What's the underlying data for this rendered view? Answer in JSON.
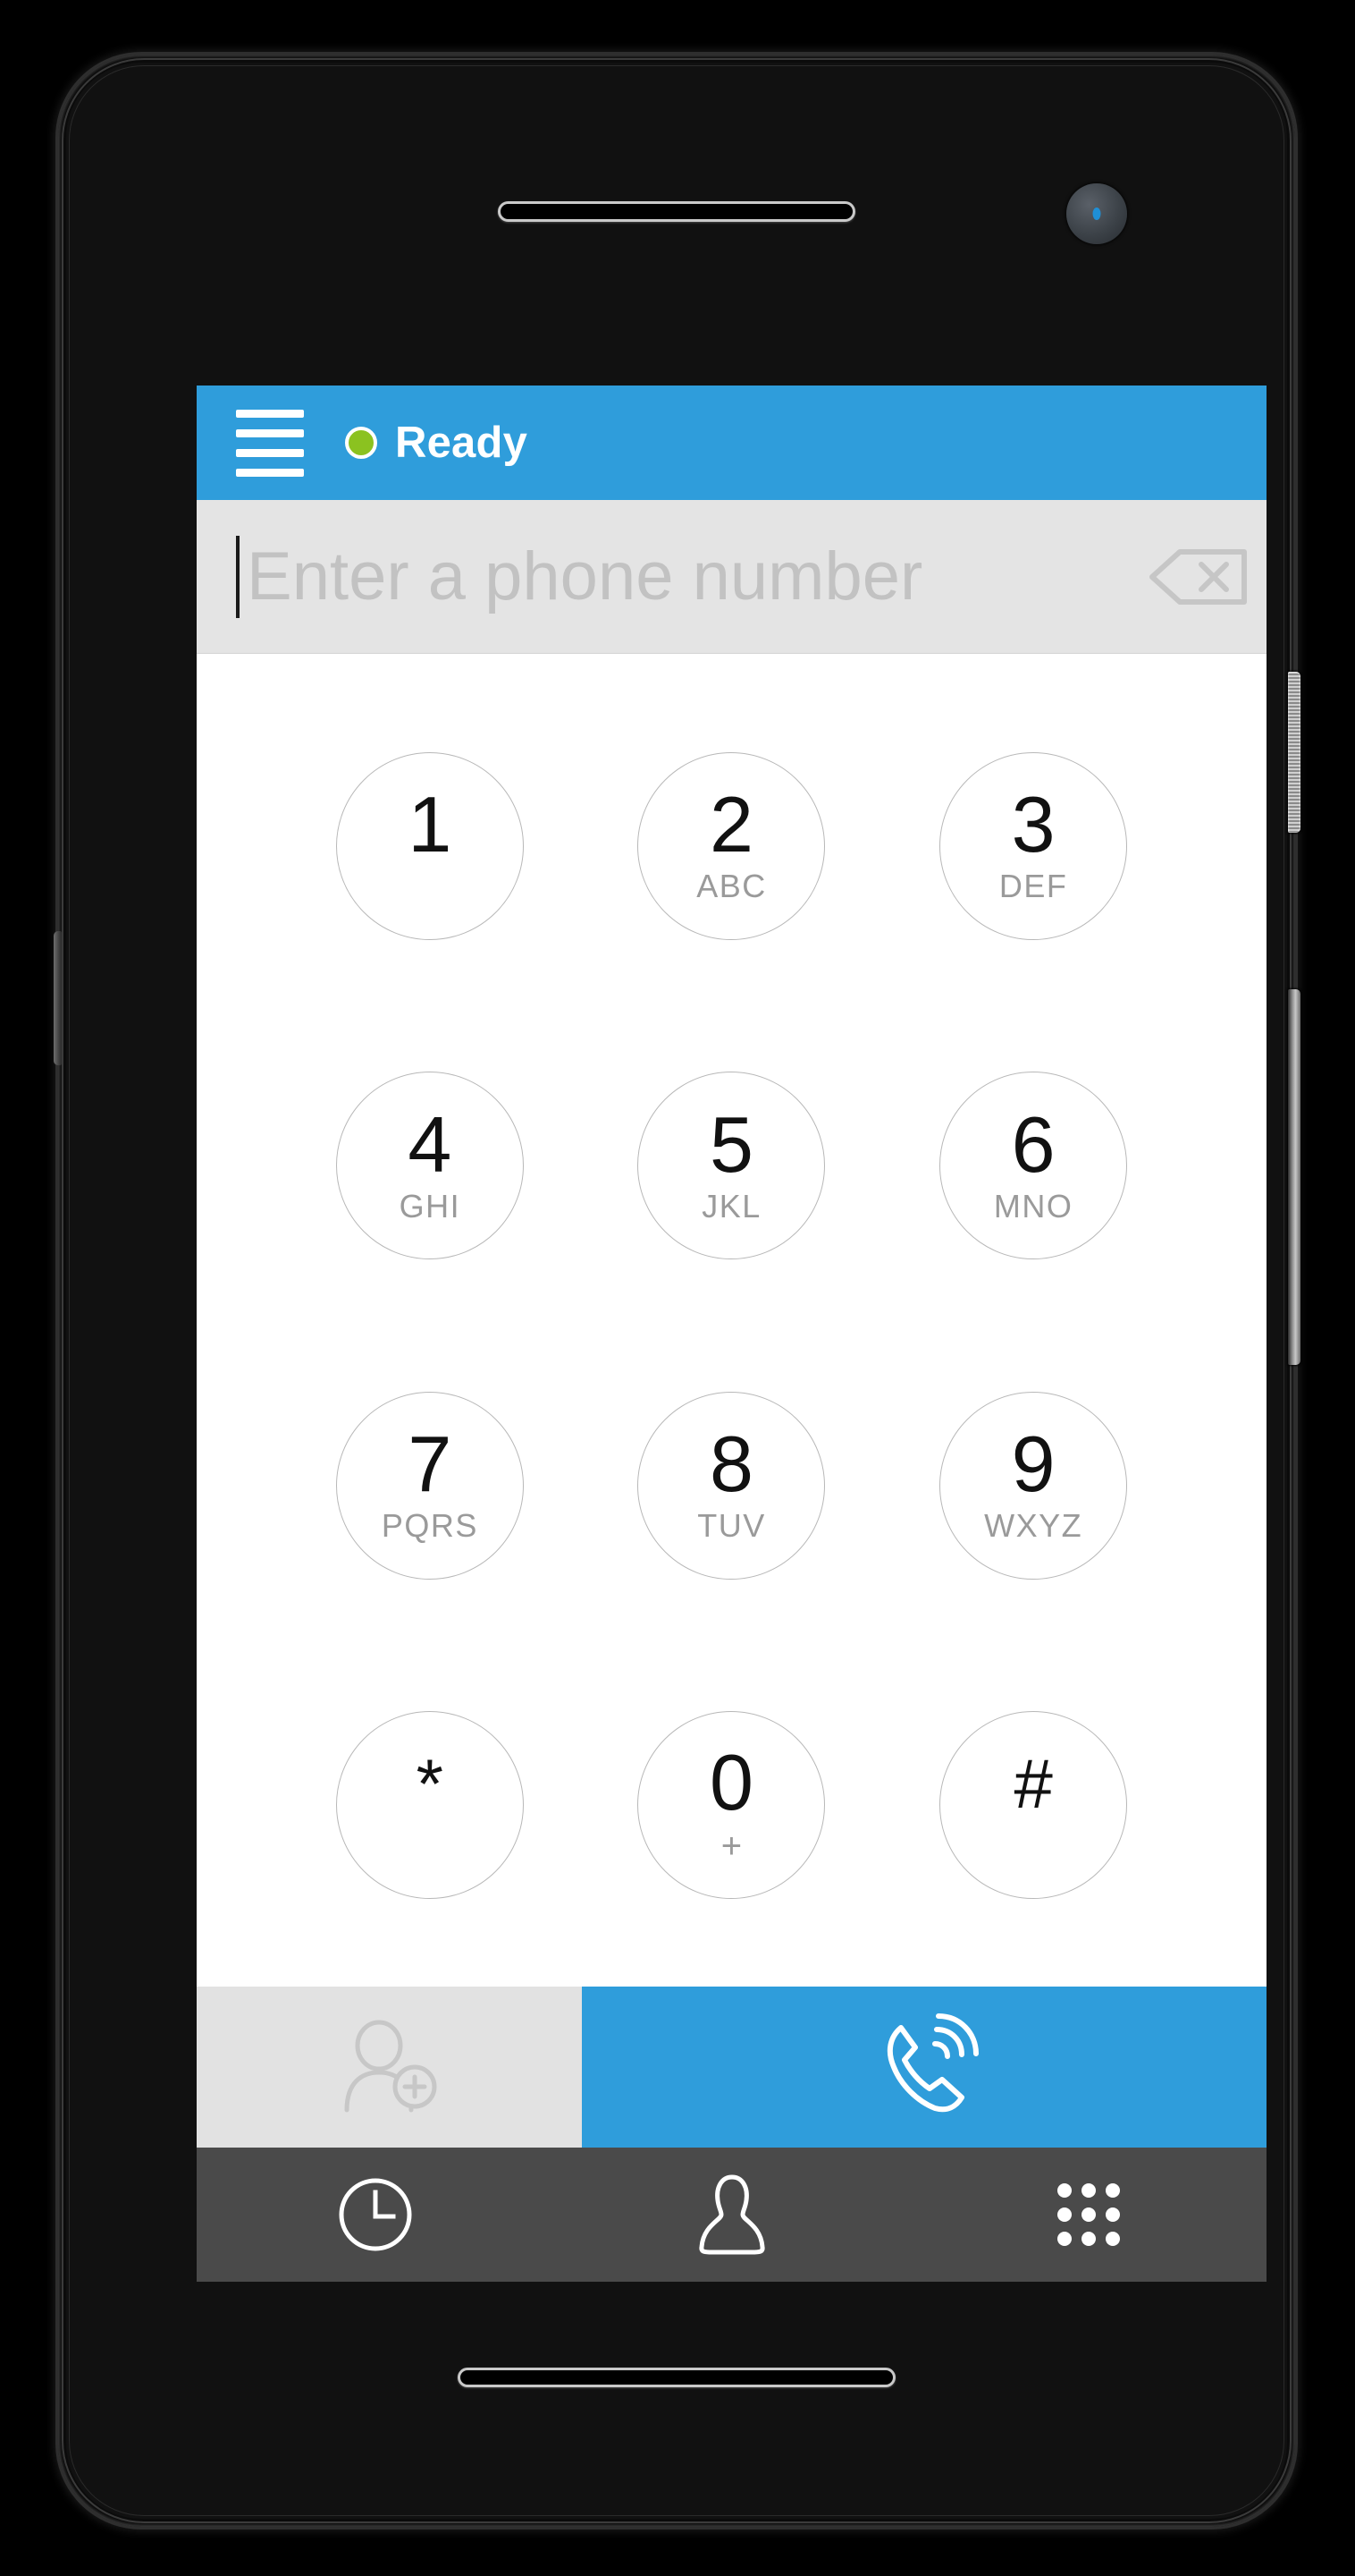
{
  "app": {
    "header": {
      "menu_icon": "hamburger-menu-icon",
      "status_label": "Ready",
      "status_color": "#8bc220",
      "background_color": "#2f9ddb"
    },
    "number_entry": {
      "value": "",
      "placeholder": "Enter a phone number",
      "backspace_icon": "backspace-delete-icon",
      "background_color": "#e4e4e4"
    },
    "dialpad": {
      "keys": [
        {
          "digit": "1",
          "letters": ""
        },
        {
          "digit": "2",
          "letters": "ABC"
        },
        {
          "digit": "3",
          "letters": "DEF"
        },
        {
          "digit": "4",
          "letters": "GHI"
        },
        {
          "digit": "5",
          "letters": "JKL"
        },
        {
          "digit": "6",
          "letters": "MNO"
        },
        {
          "digit": "7",
          "letters": "PQRS"
        },
        {
          "digit": "8",
          "letters": "TUV"
        },
        {
          "digit": "9",
          "letters": "WXYZ"
        },
        {
          "digit": "*",
          "letters": ""
        },
        {
          "digit": "0",
          "letters": "+"
        },
        {
          "digit": "#",
          "letters": ""
        }
      ]
    },
    "actions": {
      "add_contact_icon": "add-contact-icon",
      "call_icon": "call-handset-icon",
      "call_background_color": "#2f9ddb",
      "add_contact_background_color": "#e2e2e2"
    },
    "tab_bar": {
      "background_color": "#4a4a4a",
      "tabs": [
        {
          "icon": "clock-history-icon",
          "name": "history"
        },
        {
          "icon": "person-contacts-icon",
          "name": "contacts"
        },
        {
          "icon": "keypad-dots-icon",
          "name": "keypad"
        }
      ]
    }
  },
  "device": {
    "earpiece": "earpiece-speaker",
    "front_camera": "front-camera",
    "bottom_speaker": "bottom-speaker",
    "power_button": "power-button",
    "volume_button": "volume-rocker-button"
  }
}
